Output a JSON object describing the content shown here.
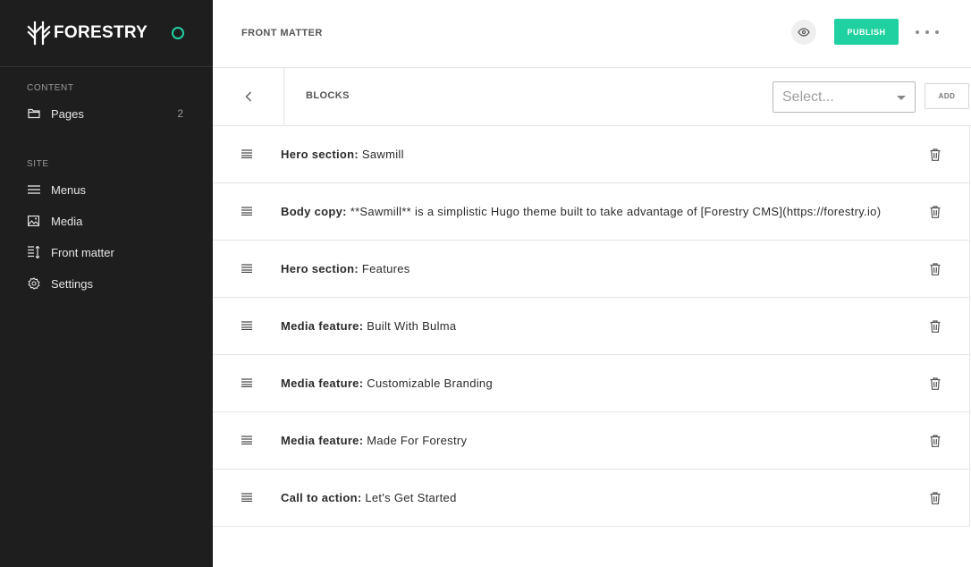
{
  "brand": {
    "name": "FORESTRY"
  },
  "sidebar": {
    "content_label": "CONTENT",
    "site_label": "SITE",
    "content_items": [
      {
        "label": "Pages",
        "count": "2",
        "icon": "folder-icon"
      }
    ],
    "site_items": [
      {
        "label": "Menus",
        "icon": "menu-icon"
      },
      {
        "label": "Media",
        "icon": "image-icon"
      },
      {
        "label": "Front matter",
        "icon": "front-matter-icon"
      },
      {
        "label": "Settings",
        "icon": "gear-icon"
      }
    ]
  },
  "header": {
    "title": "FRONT MATTER",
    "publish_label": "PUBLISH"
  },
  "blocks": {
    "label": "BLOCKS",
    "select_placeholder": "Select...",
    "add_label": "ADD",
    "items": [
      {
        "type": "Hero section:",
        "value": "Sawmill"
      },
      {
        "type": "Body copy:",
        "value": "**Sawmill** is a simplistic Hugo theme built to take advantage of [Forestry CMS](https://forestry.io)"
      },
      {
        "type": "Hero section:",
        "value": "Features"
      },
      {
        "type": "Media feature:",
        "value": "Built With Bulma"
      },
      {
        "type": "Media feature:",
        "value": "Customizable Branding"
      },
      {
        "type": "Media feature:",
        "value": "Made For Forestry"
      },
      {
        "type": "Call to action:",
        "value": "Let's Get Started"
      }
    ]
  },
  "colors": {
    "accent": "#1fd1a1",
    "sidebar_bg": "#1e1e1e"
  }
}
